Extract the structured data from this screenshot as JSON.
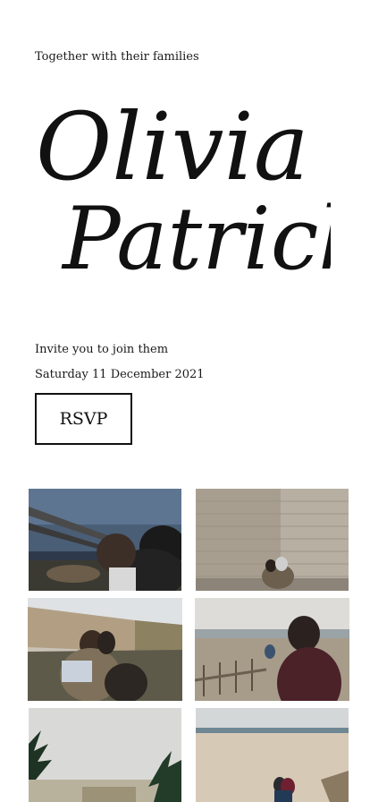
{
  "header": {
    "intro_text": "Together with their families"
  },
  "couple": {
    "name_one": "Olivia &",
    "name_two": "Patrick"
  },
  "details": {
    "invite_text": "Invite you to join them",
    "date_text": "Saturday 11 December 2021"
  },
  "actions": {
    "rsvp_label": "RSVP"
  },
  "gallery": {
    "photos": [
      "couple-by-railing-photo",
      "couple-by-brick-wall-photo",
      "couple-sitting-on-wall-photo",
      "couple-beach-steps-photo",
      "pine-trees-photo",
      "couple-on-beach-photo"
    ]
  }
}
